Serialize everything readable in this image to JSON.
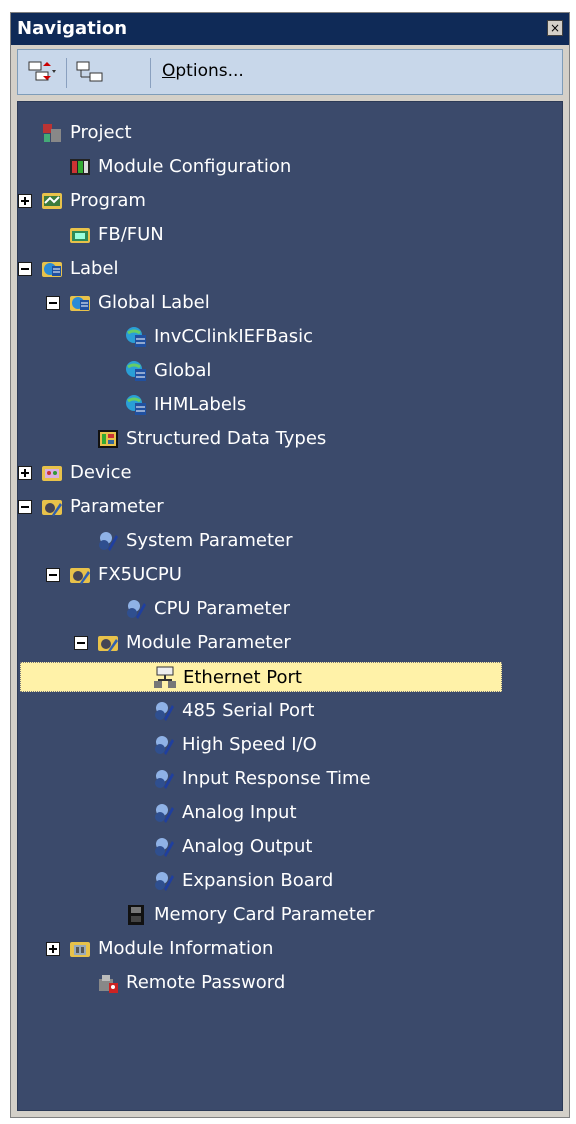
{
  "panel": {
    "title": "Navigation",
    "close_glyph": "×"
  },
  "toolbar": {
    "options_label": "Options...",
    "options_mnemonic": "O",
    "options_rest": "ptions..."
  },
  "tree": [
    {
      "label": "Project",
      "icon": "project-icon",
      "expander": "none"
    },
    {
      "label": "Module Configuration",
      "icon": "module-configuration-icon",
      "expander": "none"
    },
    {
      "label": "Program",
      "icon": "program-icon",
      "expander": "plus"
    },
    {
      "label": "FB/FUN",
      "icon": "fb-fun-icon",
      "expander": "none"
    },
    {
      "label": "Label",
      "icon": "label-icon",
      "expander": "minus"
    },
    {
      "label": "Global Label",
      "icon": "global-label-icon",
      "expander": "minus"
    },
    {
      "label": "InvCClinkIEFBasic",
      "icon": "label-globe-icon",
      "expander": "none"
    },
    {
      "label": "Global",
      "icon": "label-globe-icon",
      "expander": "none"
    },
    {
      "label": "IHMLabels",
      "icon": "label-globe-icon",
      "expander": "none"
    },
    {
      "label": "Structured Data Types",
      "icon": "structured-data-icon",
      "expander": "none"
    },
    {
      "label": "Device",
      "icon": "device-icon",
      "expander": "plus"
    },
    {
      "label": "Parameter",
      "icon": "parameter-folder-icon",
      "expander": "minus"
    },
    {
      "label": "System Parameter",
      "icon": "parameter-icon",
      "expander": "none"
    },
    {
      "label": "FX5UCPU",
      "icon": "parameter-folder-icon",
      "expander": "minus"
    },
    {
      "label": "CPU Parameter",
      "icon": "parameter-icon",
      "expander": "none"
    },
    {
      "label": "Module Parameter",
      "icon": "parameter-folder-icon",
      "expander": "minus"
    },
    {
      "label": "Ethernet Port",
      "icon": "ethernet-port-icon",
      "expander": "none",
      "selected": true
    },
    {
      "label": "485 Serial Port",
      "icon": "parameter-icon",
      "expander": "none"
    },
    {
      "label": "High Speed I/O",
      "icon": "parameter-icon",
      "expander": "none"
    },
    {
      "label": "Input Response Time",
      "icon": "parameter-icon",
      "expander": "none"
    },
    {
      "label": "Analog Input",
      "icon": "parameter-icon",
      "expander": "none"
    },
    {
      "label": "Analog Output",
      "icon": "parameter-icon",
      "expander": "none"
    },
    {
      "label": "Expansion Board",
      "icon": "parameter-icon",
      "expander": "none"
    },
    {
      "label": "Memory Card Parameter",
      "icon": "memory-card-icon",
      "expander": "none"
    },
    {
      "label": "Module Information",
      "icon": "module-information-icon",
      "expander": "plus"
    },
    {
      "label": "Remote Password",
      "icon": "remote-password-icon",
      "expander": "none"
    }
  ]
}
